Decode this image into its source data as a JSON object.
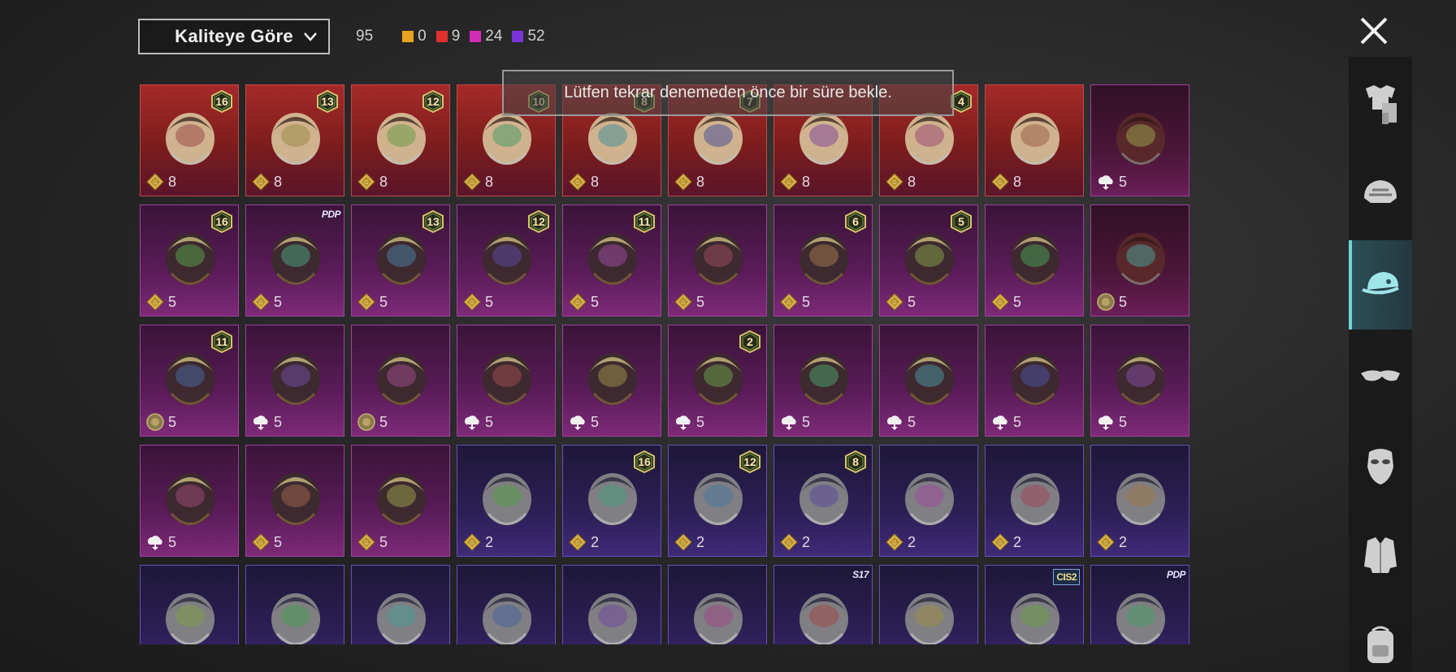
{
  "sort_dropdown": {
    "label": "Kaliteye Göre"
  },
  "stats": {
    "total": "95",
    "counts": [
      {
        "value": "0",
        "color": "#e8a21f"
      },
      {
        "value": "9",
        "color": "#e0312f"
      },
      {
        "value": "24",
        "color": "#d22bb8"
      },
      {
        "value": "52",
        "color": "#7a35d8"
      }
    ]
  },
  "toast": "Lütfen tekrar denemeden önce bir süre bekle.",
  "items": [
    {
      "rarity": "red",
      "icon": "cat-ear-hat-icon",
      "level": "16",
      "cost": "8",
      "currency": "coin"
    },
    {
      "rarity": "red",
      "icon": "ribbon-hat-icon",
      "level": "13",
      "cost": "8",
      "currency": "coin"
    },
    {
      "rarity": "red",
      "icon": "bunny-wig-icon",
      "level": "12",
      "cost": "8",
      "currency": "coin"
    },
    {
      "rarity": "red",
      "icon": "dark-wig-icon",
      "level": "10",
      "cost": "8",
      "currency": "coin"
    },
    {
      "rarity": "red",
      "icon": "blonde-wig-icon",
      "level": "8",
      "cost": "8",
      "currency": "coin"
    },
    {
      "rarity": "red",
      "icon": "white-wig-icon",
      "level": "7",
      "cost": "8",
      "currency": "coin"
    },
    {
      "rarity": "red",
      "icon": "gold-horned-helmet-icon",
      "level": "",
      "cost": "8",
      "currency": "coin"
    },
    {
      "rarity": "red",
      "icon": "snowman-top-hat-icon",
      "level": "4",
      "cost": "8",
      "currency": "coin"
    },
    {
      "rarity": "red",
      "icon": "teal-dragon-mask-icon",
      "level": "",
      "cost": "8",
      "currency": "coin"
    },
    {
      "rarity": "blank",
      "icon": "brown-hair-icon",
      "level": "",
      "cost": "5",
      "currency": "cloud"
    },
    {
      "rarity": "magenta",
      "icon": "headphones-hair-icon",
      "level": "16",
      "cost": "5",
      "currency": "coin"
    },
    {
      "rarity": "magenta",
      "icon": "ribbon-hair-icon",
      "tag": "PDP",
      "level": "",
      "cost": "5",
      "currency": "coin"
    },
    {
      "rarity": "magenta",
      "icon": "aviator-goggles-icon",
      "level": "13",
      "cost": "5",
      "currency": "coin"
    },
    {
      "rarity": "magenta",
      "icon": "orange-hair-icon",
      "level": "12",
      "cost": "5",
      "currency": "coin"
    },
    {
      "rarity": "magenta",
      "icon": "flower-crown-icon",
      "level": "11",
      "cost": "5",
      "currency": "coin"
    },
    {
      "rarity": "magenta",
      "icon": "officer-cap-icon",
      "level": "",
      "cost": "5",
      "currency": "coin"
    },
    {
      "rarity": "magenta",
      "icon": "gold-visor-helmet-icon",
      "level": "6",
      "cost": "5",
      "currency": "coin"
    },
    {
      "rarity": "magenta",
      "icon": "pigtails-bow-icon",
      "level": "5",
      "cost": "5",
      "currency": "coin"
    },
    {
      "rarity": "magenta",
      "icon": "potato-head-icon",
      "level": "",
      "cost": "5",
      "currency": "coin"
    },
    {
      "rarity": "blank",
      "icon": "red-bow-headband-icon",
      "level": "",
      "cost": "5",
      "currency": "medal"
    },
    {
      "rarity": "magenta",
      "icon": "golden-hat-icon",
      "level": "11",
      "cost": "5",
      "currency": "medal"
    },
    {
      "rarity": "magenta",
      "icon": "mecha-helmet-icon",
      "level": "",
      "cost": "5",
      "currency": "cloud"
    },
    {
      "rarity": "magenta",
      "icon": "lantern-hat-icon",
      "level": "",
      "cost": "5",
      "currency": "medal"
    },
    {
      "rarity": "magenta",
      "icon": "crescent-blade-icon",
      "level": "",
      "cost": "5",
      "currency": "cloud"
    },
    {
      "rarity": "magenta",
      "icon": "pharaoh-hat-icon",
      "level": "",
      "cost": "5",
      "currency": "cloud"
    },
    {
      "rarity": "magenta",
      "icon": "predator-mask-icon",
      "level": "2",
      "cost": "5",
      "currency": "cloud"
    },
    {
      "rarity": "magenta",
      "icon": "lion-dreadlocks-icon",
      "level": "",
      "cost": "5",
      "currency": "cloud"
    },
    {
      "rarity": "magenta",
      "icon": "armored-hood-icon",
      "level": "",
      "cost": "5",
      "currency": "cloud"
    },
    {
      "rarity": "magenta",
      "icon": "space-helmet-icon",
      "level": "",
      "cost": "5",
      "currency": "cloud"
    },
    {
      "rarity": "magenta",
      "icon": "grey-beanie-icon",
      "level": "",
      "cost": "5",
      "currency": "cloud"
    },
    {
      "rarity": "magenta",
      "icon": "blue-feather-mask-icon",
      "level": "",
      "cost": "5",
      "currency": "cloud"
    },
    {
      "rarity": "magenta",
      "icon": "headband-icon",
      "level": "",
      "cost": "5",
      "currency": "coin"
    },
    {
      "rarity": "magenta",
      "icon": "devil-horns-icon",
      "level": "",
      "cost": "5",
      "currency": "coin"
    },
    {
      "rarity": "purple",
      "icon": "silver-hair-icon",
      "level": "",
      "cost": "2",
      "currency": "coin"
    },
    {
      "rarity": "purple",
      "icon": "beanie-goggles-icon",
      "level": "16",
      "cost": "2",
      "currency": "coin"
    },
    {
      "rarity": "purple",
      "icon": "bunny-helmet-icon",
      "level": "12",
      "cost": "2",
      "currency": "coin"
    },
    {
      "rarity": "purple",
      "icon": "skull-mask-icon",
      "level": "8",
      "cost": "2",
      "currency": "coin"
    },
    {
      "rarity": "purple",
      "icon": "baseball-cap-icon",
      "level": "",
      "cost": "2",
      "currency": "coin"
    },
    {
      "rarity": "purple",
      "icon": "gas-mask-helmet-icon",
      "level": "",
      "cost": "2",
      "currency": "coin"
    },
    {
      "rarity": "purple",
      "icon": "tactical-helmet-icon",
      "level": "",
      "cost": "2",
      "currency": "coin"
    },
    {
      "rarity": "purple",
      "icon": "goggles-hair-icon",
      "level": "",
      "cost": "",
      "currency": ""
    },
    {
      "rarity": "purple",
      "icon": "blonde-feather-hair-icon",
      "level": "",
      "cost": "",
      "currency": ""
    },
    {
      "rarity": "purple",
      "icon": "sun-hat-icon",
      "level": "",
      "cost": "",
      "currency": ""
    },
    {
      "rarity": "purple",
      "icon": "knit-cap-icon",
      "level": "",
      "cost": "",
      "currency": ""
    },
    {
      "rarity": "purple",
      "icon": "snapback-cap-icon",
      "level": "",
      "cost": "",
      "currency": ""
    },
    {
      "rarity": "purple",
      "icon": "bucket-hat-icon",
      "level": "",
      "cost": "",
      "currency": ""
    },
    {
      "rarity": "purple",
      "icon": "horned-helmet-icon",
      "tag": "S17",
      "level": "",
      "cost": "",
      "currency": ""
    },
    {
      "rarity": "purple",
      "icon": "red-fez-icon",
      "level": "",
      "cost": "",
      "currency": ""
    },
    {
      "rarity": "purple",
      "icon": "flag-cap-icon",
      "tag": "CIS2",
      "level": "",
      "cost": "",
      "currency": ""
    },
    {
      "rarity": "purple",
      "icon": "grey-hair-icon",
      "tag": "PDP",
      "level": "",
      "cost": "",
      "currency": ""
    }
  ],
  "sidebar": [
    {
      "icon": "outfit-icon",
      "active": false
    },
    {
      "icon": "helmet-icon",
      "active": false
    },
    {
      "icon": "cap-icon",
      "active": true
    },
    {
      "icon": "glasses-icon",
      "active": false
    },
    {
      "icon": "mask-icon",
      "active": false
    },
    {
      "icon": "jacket-icon",
      "active": false
    },
    {
      "icon": "backpack-icon",
      "active": false
    }
  ]
}
